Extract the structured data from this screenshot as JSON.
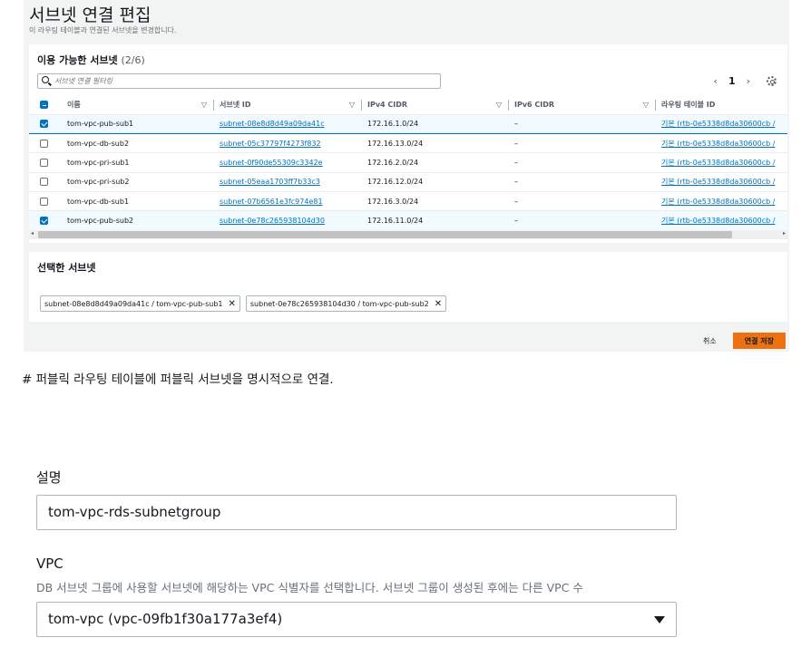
{
  "modal": {
    "title": "서브넷 연결 편집",
    "subtitle": "이 라우팅 테이블과 연결된 서브넷을 변경합니다.",
    "available": {
      "heading": "이용 가능한 서브넷",
      "count": "(2/6)",
      "filter_placeholder": "서브넷 연결 필터링",
      "page": "1",
      "columns": [
        "이름",
        "서브넷 ID",
        "IPv4 CIDR",
        "IPv6 CIDR",
        "라우팅 테이블 ID"
      ],
      "rows": [
        {
          "checked": true,
          "name": "tom-vpc-pub-sub1",
          "subnet_id": "subnet-08e8d8d49a09da41c",
          "ipv4": "172.16.1.0/24",
          "ipv6": "–",
          "rtb": "기본 (rtb-0e5338d8da30600cb /"
        },
        {
          "checked": false,
          "name": "tom-vpc-db-sub2",
          "subnet_id": "subnet-05c37797f4273f832",
          "ipv4": "172.16.13.0/24",
          "ipv6": "–",
          "rtb": "기본 (rtb-0e5338d8da30600cb /"
        },
        {
          "checked": false,
          "name": "tom-vpc-pri-sub1",
          "subnet_id": "subnet-0f90de55309c3342e",
          "ipv4": "172.16.2.0/24",
          "ipv6": "–",
          "rtb": "기본 (rtb-0e5338d8da30600cb /"
        },
        {
          "checked": false,
          "name": "tom-vpc-pri-sub2",
          "subnet_id": "subnet-05eaa1703ff7b33c3",
          "ipv4": "172.16.12.0/24",
          "ipv6": "–",
          "rtb": "기본 (rtb-0e5338d8da30600cb /"
        },
        {
          "checked": false,
          "name": "tom-vpc-db-sub1",
          "subnet_id": "subnet-07b6561e3fc974e81",
          "ipv4": "172.16.3.0/24",
          "ipv6": "–",
          "rtb": "기본 (rtb-0e5338d8da30600cb /"
        },
        {
          "checked": true,
          "name": "tom-vpc-pub-sub2",
          "subnet_id": "subnet-0e78c265938104d30",
          "ipv4": "172.16.11.0/24",
          "ipv6": "–",
          "rtb": "기본 (rtb-0e5338d8da30600cb /"
        }
      ]
    },
    "selected": {
      "heading": "선택한 서브넷",
      "tokens": [
        "subnet-08e8d8d49a09da41c / tom-vpc-pub-sub1",
        "subnet-0e78c265938104d30 / tom-vpc-pub-sub2"
      ]
    },
    "cancel_label": "취소",
    "save_label": "연결 저장",
    "accent_color": "#ec7211",
    "link_color": "#0073bb"
  },
  "caption": "# 퍼블릭 라우팅 테이블에 퍼블릭 서브넷을 명시적으로 연결.",
  "form": {
    "desc_label": "설명",
    "desc_value": "tom-vpc-rds-subnetgroup",
    "vpc_label": "VPC",
    "vpc_help": "DB 서브넷 그룹에 사용할 서브넷에 해당하는 VPC 식별자를 선택합니다. 서브넷 그룹이 생성된 후에는 다른 VPC 수",
    "vpc_value": "tom-vpc (vpc-09fb1f30a177a3ef4)"
  }
}
